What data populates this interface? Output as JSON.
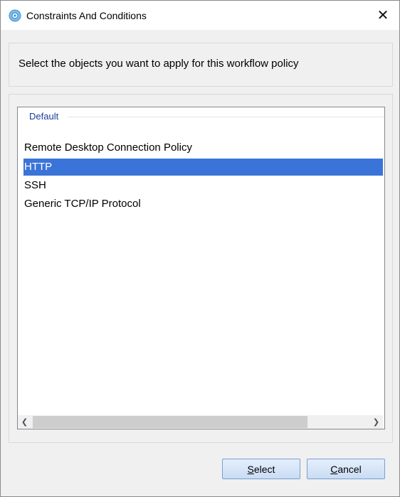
{
  "window": {
    "title": "Constraints And Conditions",
    "close_glyph": "✕",
    "icon": "gear-icon"
  },
  "instruction": {
    "text": "Select the objects you want to apply for this workflow policy"
  },
  "list": {
    "group_header": "Default",
    "items": [
      {
        "label": "Remote Desktop Connection Policy",
        "selected": false
      },
      {
        "label": "HTTP",
        "selected": true
      },
      {
        "label": "SSH",
        "selected": false
      },
      {
        "label": "Generic TCP/IP Protocol",
        "selected": false
      }
    ],
    "scroll_left_glyph": "❮",
    "scroll_right_glyph": "❯"
  },
  "buttons": {
    "select": {
      "mnemonic": "S",
      "rest": "elect"
    },
    "cancel": {
      "mnemonic": "C",
      "rest": "ancel"
    }
  },
  "colors": {
    "selection": "#3b74d8",
    "group_header": "#1e3c9b",
    "button_border": "#7a9fd4"
  }
}
